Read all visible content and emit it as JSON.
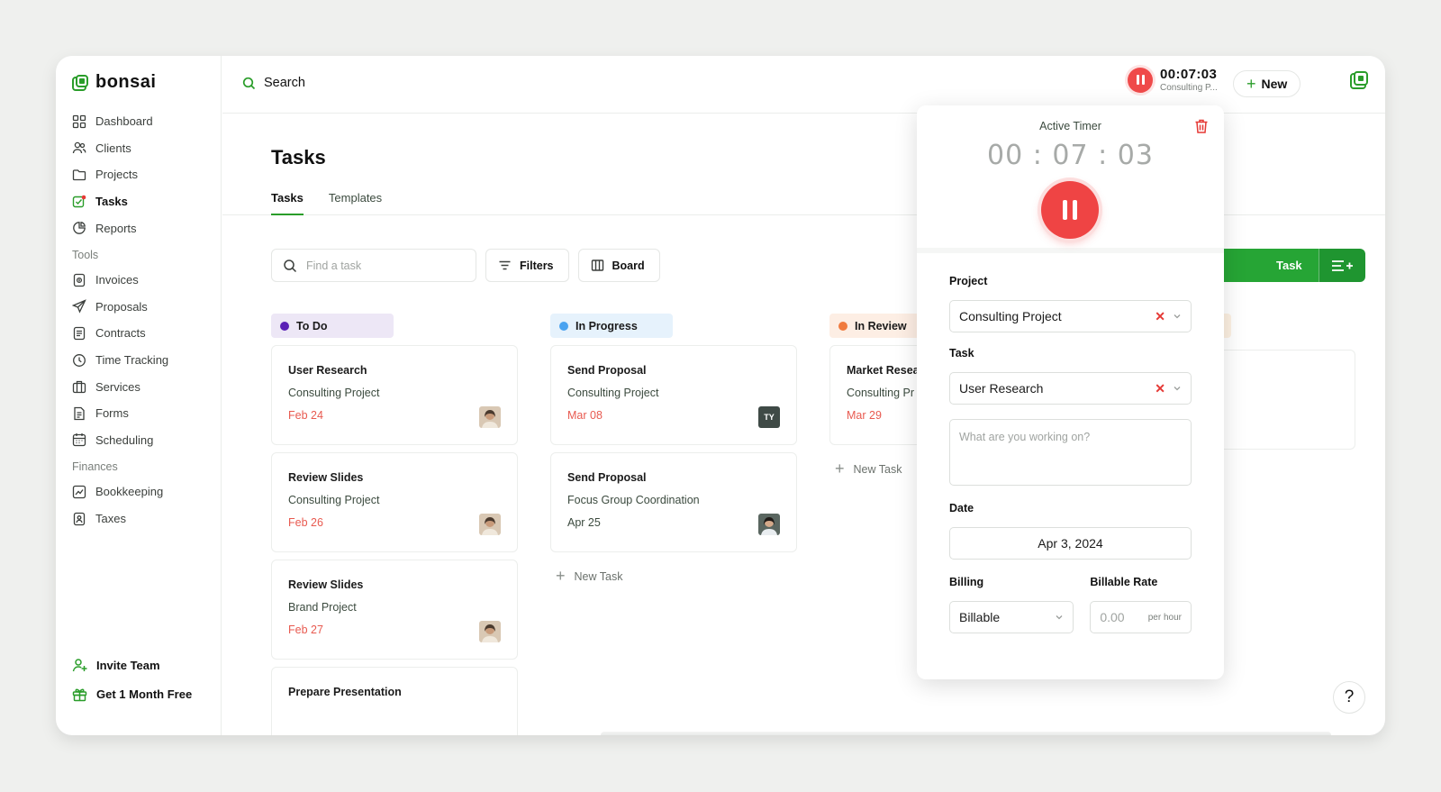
{
  "app": {
    "brand": "bonsai",
    "brand_color": "#2a9d2a"
  },
  "sidebar": {
    "main": [
      {
        "label": "Dashboard",
        "icon": "dashboard-icon"
      },
      {
        "label": "Clients",
        "icon": "clients-icon"
      },
      {
        "label": "Projects",
        "icon": "folder-icon"
      },
      {
        "label": "Tasks",
        "icon": "tasks-icon",
        "active": true
      },
      {
        "label": "Reports",
        "icon": "reports-icon"
      }
    ],
    "tools_heading": "Tools",
    "tools": [
      {
        "label": "Invoices",
        "icon": "invoice-icon"
      },
      {
        "label": "Proposals",
        "icon": "proposal-icon"
      },
      {
        "label": "Contracts",
        "icon": "contract-icon"
      },
      {
        "label": "Time Tracking",
        "icon": "clock-icon"
      },
      {
        "label": "Services",
        "icon": "services-icon"
      },
      {
        "label": "Forms",
        "icon": "forms-icon"
      },
      {
        "label": "Scheduling",
        "icon": "calendar-icon"
      }
    ],
    "finances_heading": "Finances",
    "finances": [
      {
        "label": "Bookkeeping",
        "icon": "bookkeeping-icon"
      },
      {
        "label": "Taxes",
        "icon": "taxes-icon"
      }
    ],
    "invite": "Invite Team",
    "promo": "Get 1 Month Free"
  },
  "topbar": {
    "search_label": "Search",
    "timer_time": "00:07:03",
    "timer_project": "Consulting P...",
    "new_label": "New"
  },
  "page": {
    "title": "Tasks",
    "tabs": [
      "Tasks",
      "Templates"
    ],
    "find_placeholder": "Find a task",
    "filters_label": "Filters",
    "view_label": "Board",
    "add_task_label": "Task"
  },
  "columns": [
    {
      "name": "To Do",
      "dot": "#5b21b6",
      "bg": "#ede7f6",
      "cards": [
        {
          "title": "User Research",
          "project": "Consulting Project",
          "date": "Feb 24",
          "overdue": true,
          "avatar": "photo"
        },
        {
          "title": "Review Slides",
          "project": "Consulting Project",
          "date": "Feb 26",
          "overdue": true,
          "avatar": "photo"
        },
        {
          "title": "Review Slides",
          "project": "Brand Project",
          "date": "Feb 27",
          "overdue": true,
          "avatar": "photo"
        },
        {
          "title": "Prepare Presentation",
          "project": "",
          "date": "",
          "overdue": false,
          "avatar": ""
        }
      ]
    },
    {
      "name": "In Progress",
      "dot": "#4aa3f0",
      "bg": "#e6f2fc",
      "cards": [
        {
          "title": "Send Proposal",
          "project": "Consulting Project",
          "date": "Mar 08",
          "overdue": true,
          "avatar": "TY"
        },
        {
          "title": "Send Proposal",
          "project": "Focus Group Coordination",
          "date": "Apr 25",
          "overdue": false,
          "avatar": "photo2"
        }
      ],
      "new_task": "New Task"
    },
    {
      "name": "In Review",
      "dot": "#f07b3f",
      "bg": "#fdeee4",
      "cards": [
        {
          "title": "Market Resea",
          "project": "Consulting Pr",
          "date": "Mar 29",
          "overdue": true,
          "avatar": ""
        }
      ],
      "new_task": "New Task"
    }
  ],
  "timer_panel": {
    "label": "Active Timer",
    "time": "00 : 07 : 03",
    "project_label": "Project",
    "project_value": "Consulting Project",
    "task_label": "Task",
    "task_value": "User Research",
    "notes_placeholder": "What are you working on?",
    "date_label": "Date",
    "date_value": "Apr 3, 2024",
    "billing_label": "Billing",
    "billing_value": "Billable",
    "rate_label": "Billable Rate",
    "rate_value": "0.00",
    "rate_unit": "per hour"
  },
  "help_label": "?"
}
